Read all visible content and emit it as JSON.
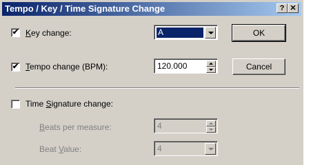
{
  "dialog": {
    "title": "Tempo / Key / Time Signature Change",
    "help_button": "?",
    "close_button": "✕"
  },
  "key_change": {
    "checked": true,
    "mark": "✔",
    "label_prefix": "",
    "label_accel": "K",
    "label_rest": "ey change:",
    "value": "A"
  },
  "tempo_change": {
    "checked": true,
    "mark": "✔",
    "label_accel": "T",
    "label_rest": "empo change (BPM):",
    "value": "120.000"
  },
  "time_signature": {
    "checked": false,
    "label_prefix": "Time ",
    "label_accel": "S",
    "label_rest": "ignature change:",
    "beats_label_prefix": "",
    "beats_label_accel": "B",
    "beats_label_rest": "eats per measure:",
    "beats_value": "4",
    "beat_value_label_prefix": "Beat ",
    "beat_value_label_accel": "V",
    "beat_value_label_rest": "alue:",
    "beat_value": "4"
  },
  "buttons": {
    "ok": "OK",
    "cancel": "Cancel"
  }
}
